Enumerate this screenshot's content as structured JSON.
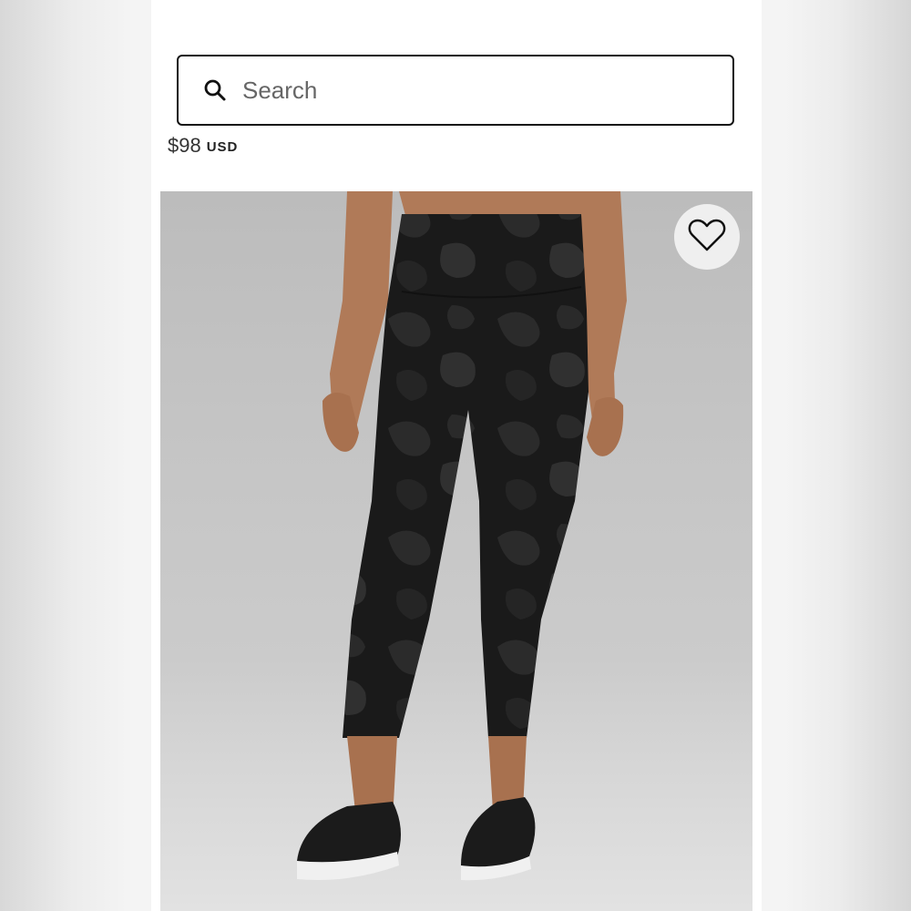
{
  "search": {
    "placeholder": "Search"
  },
  "product": {
    "price": "$98",
    "currency": "USD"
  },
  "icons": {
    "search": "search-icon",
    "wishlist": "heart-icon"
  },
  "colors": {
    "border": "#111111",
    "background": "#ffffff",
    "image_backdrop": "#c6c6c6"
  }
}
